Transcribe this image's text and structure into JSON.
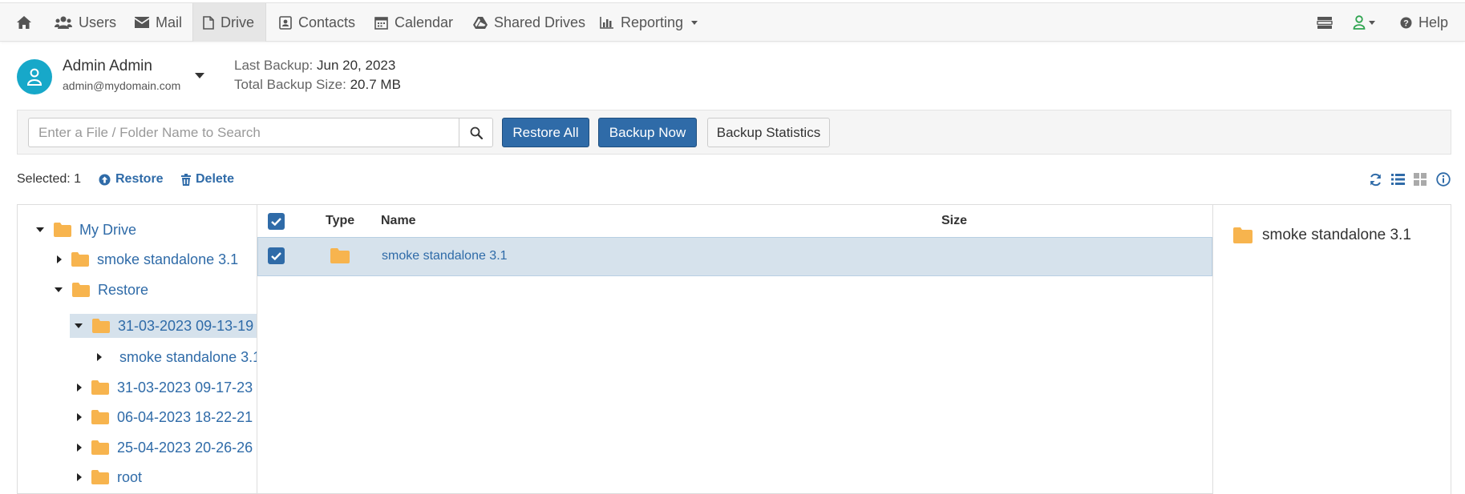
{
  "nav": {
    "items": [
      {
        "label": "Users"
      },
      {
        "label": "Mail"
      },
      {
        "label": "Drive"
      },
      {
        "label": "Contacts"
      },
      {
        "label": "Calendar"
      },
      {
        "label": "Shared Drives"
      },
      {
        "label": "Reporting"
      }
    ],
    "help_label": "Help",
    "active": "Drive"
  },
  "user": {
    "name": "Admin Admin",
    "email": "admin@mydomain.com"
  },
  "backup": {
    "last_backup_label": "Last Backup:",
    "last_backup_value": "Jun 20, 2023",
    "total_size_label": "Total Backup Size:",
    "total_size_value": "20.7 MB"
  },
  "toolbar": {
    "search_placeholder": "Enter a File / Folder Name to Search",
    "restore_all_label": "Restore All",
    "backup_now_label": "Backup Now",
    "backup_statistics_label": "Backup Statistics"
  },
  "actions": {
    "selected_label": "Selected: 1",
    "restore_label": "Restore",
    "delete_label": "Delete"
  },
  "tree": {
    "items": [
      {
        "label": "My Drive",
        "expanded": true
      },
      {
        "label": "smoke standalone 3.1",
        "expanded": false
      },
      {
        "label": "Restore",
        "expanded": true
      },
      {
        "label": "31-03-2023 09-13-19",
        "expanded": true,
        "selected": true
      },
      {
        "label": "smoke standalone 3.1",
        "expanded": false
      },
      {
        "label": "31-03-2023 09-17-23",
        "expanded": false
      },
      {
        "label": "06-04-2023 18-22-21",
        "expanded": false
      },
      {
        "label": "25-04-2023 20-26-26",
        "expanded": false
      },
      {
        "label": "root",
        "expanded": false
      }
    ]
  },
  "list": {
    "columns": [
      "Type",
      "Name",
      "Size"
    ],
    "rows": [
      {
        "type": "folder-icon",
        "name": "smoke standalone 3.1",
        "size": "",
        "checked": true
      }
    ]
  },
  "details": {
    "title": "smoke standalone 3.1"
  },
  "colors": {
    "primary": "#2f6ba8",
    "avatar": "#17a8c9",
    "folder": "#f7b44e",
    "selection": "#d6e2ec",
    "account_icon": "#2ea44f"
  }
}
